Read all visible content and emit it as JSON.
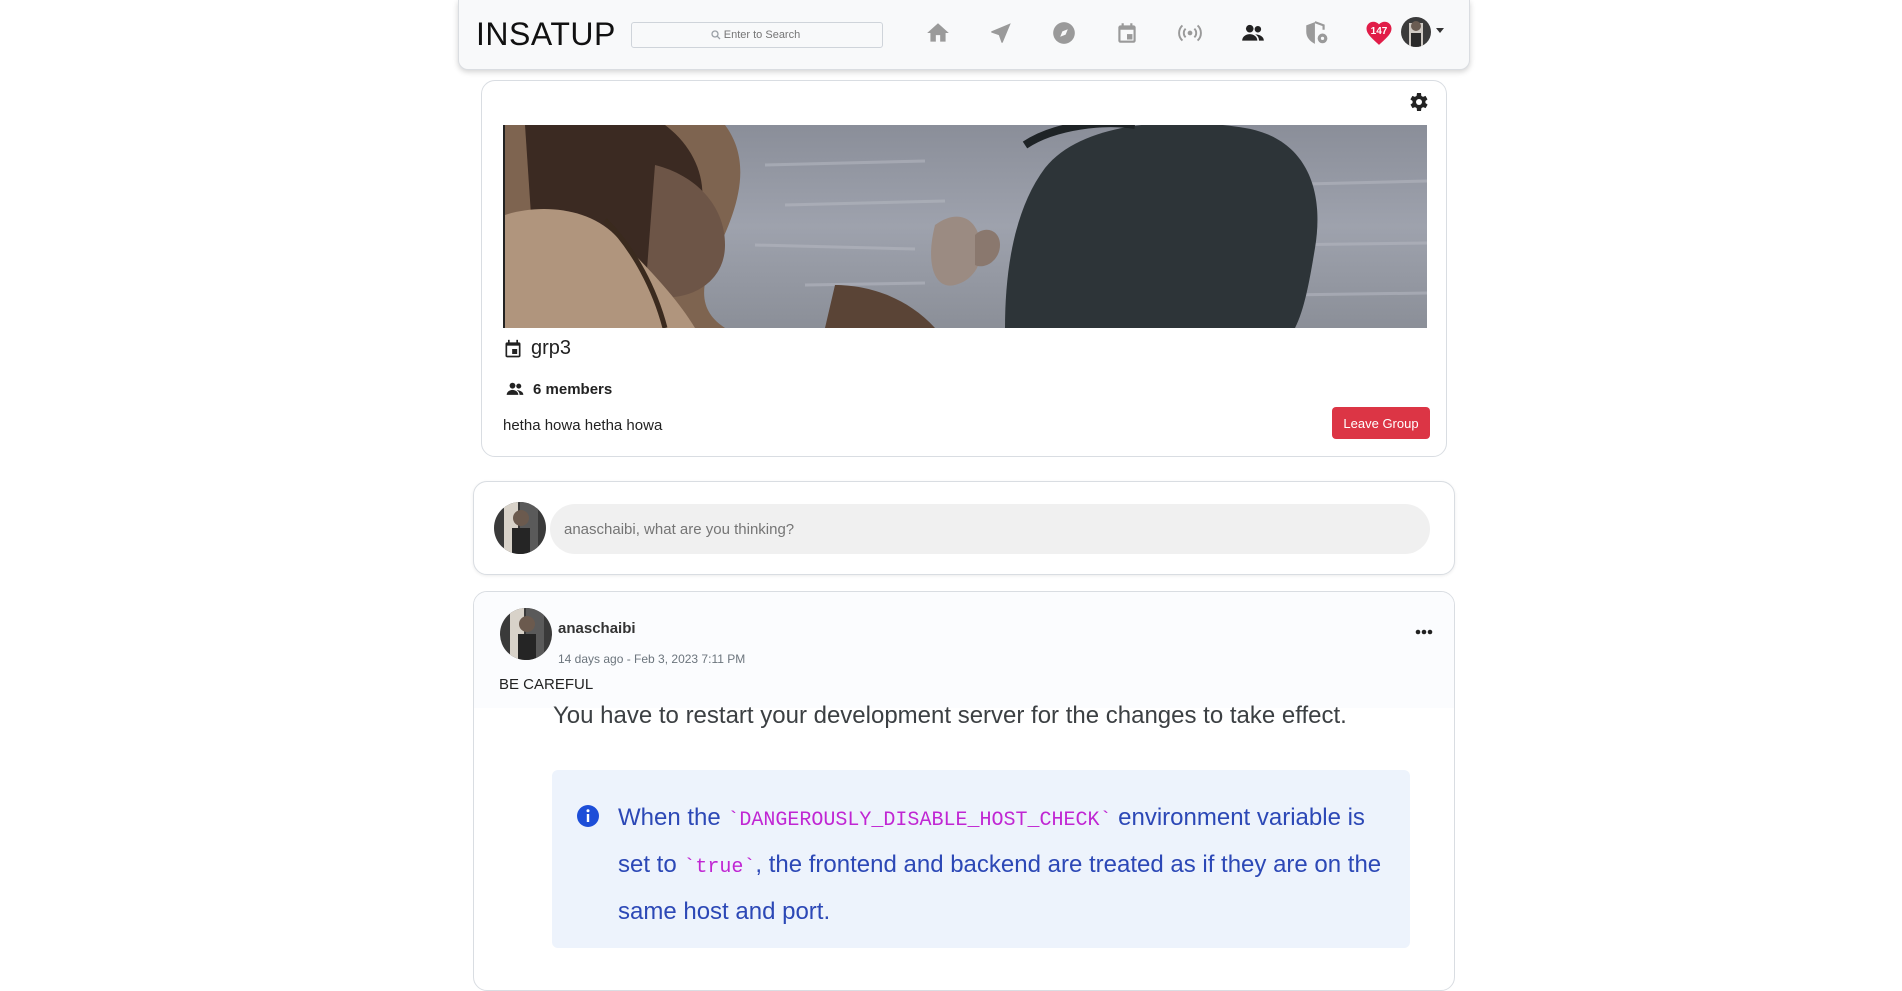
{
  "navbar": {
    "brand": "INSATUP",
    "search_placeholder": "Enter to Search",
    "icons": [
      "home-icon",
      "navigate-icon",
      "explore-icon",
      "event-icon",
      "broadcast-icon",
      "groups-icon",
      "admin-shield-icon",
      "heart-notifications-icon"
    ],
    "notification_count": "147"
  },
  "group": {
    "name": "grp3",
    "members": "6 members",
    "description": "hetha howa hetha howa",
    "leave_label": "Leave Group"
  },
  "composer": {
    "placeholder": "anaschaibi, what are you thinking?"
  },
  "post": {
    "author": "anaschaibi",
    "time": "14 days ago - Feb 3, 2023 7:11 PM",
    "text": "BE CAREFUL",
    "image_text": {
      "line1": "You have to restart your development server for the changes to take effect.",
      "info_pre": "When the ",
      "info_code1": "`DANGEROUSLY_DISABLE_HOST_CHECK`",
      "info_mid1": " environment variable is set to ",
      "info_code2": "`true`",
      "info_post": ", the frontend and backend are treated as if they are on the same host and port."
    }
  },
  "colors": {
    "danger": "#dc3545",
    "heart": "#e11d48",
    "info_text": "#2c48b6",
    "info_bg": "#edf3fc",
    "code": "#c026d3"
  }
}
